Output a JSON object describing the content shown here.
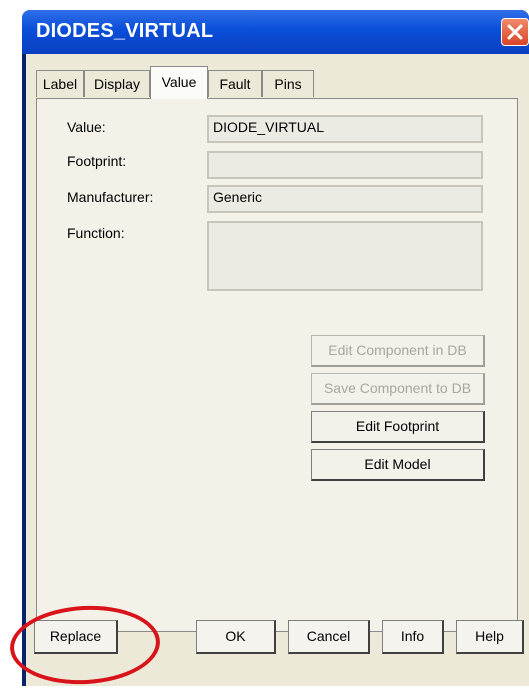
{
  "window": {
    "title": "DIODES_VIRTUAL"
  },
  "tabs": [
    {
      "label": "Label"
    },
    {
      "label": "Display"
    },
    {
      "label": "Value"
    },
    {
      "label": "Fault"
    },
    {
      "label": "Pins"
    }
  ],
  "active_tab": "Value",
  "fields": {
    "value": {
      "label": "Value:",
      "value": "DIODE_VIRTUAL"
    },
    "footprint": {
      "label": "Footprint:",
      "value": ""
    },
    "manufacturer": {
      "label": "Manufacturer:",
      "value": "Generic"
    },
    "function": {
      "label": "Function:",
      "value": ""
    }
  },
  "panel_buttons": {
    "edit_component_db": "Edit Component in DB",
    "save_component_db": "Save Component to DB",
    "edit_footprint": "Edit Footprint",
    "edit_model": "Edit Model"
  },
  "bottom_buttons": {
    "replace": "Replace",
    "ok": "OK",
    "cancel": "Cancel",
    "info": "Info",
    "help": "Help"
  },
  "colors": {
    "titlebar": "#0a4ed8",
    "dialog_bg": "#ece9d8",
    "highlight": "#d8141a",
    "close_button": "#d9442a"
  },
  "annotation": {
    "shape": "ellipse",
    "target": "replace-button"
  }
}
